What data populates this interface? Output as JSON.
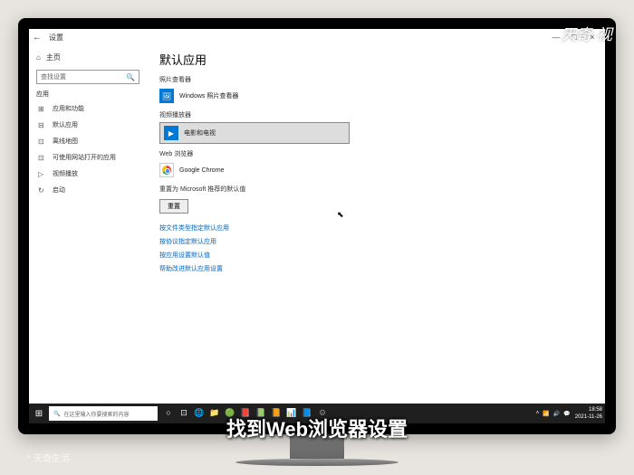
{
  "watermarks": {
    "top_right": "天奇·视",
    "caption": "找到Web浏览器设置",
    "bottom_left": "天奇生活"
  },
  "titlebar": {
    "back": "←",
    "title": "设置",
    "min": "—",
    "max": "□",
    "close": "×"
  },
  "sidebar": {
    "home_icon": "⌂",
    "home": "主页",
    "search_placeholder": "查找设置",
    "section": "应用",
    "items": [
      {
        "icon": "⊞",
        "label": "应用和功能"
      },
      {
        "icon": "⊟",
        "label": "默认应用"
      },
      {
        "icon": "⊡",
        "label": "离线地图"
      },
      {
        "icon": "⊡",
        "label": "可使用网站打开的应用"
      },
      {
        "icon": "▷",
        "label": "视频播放"
      },
      {
        "icon": "↻",
        "label": "启动"
      }
    ]
  },
  "content": {
    "heading": "默认应用",
    "sections": {
      "photo": {
        "label": "照片查看器",
        "app": "Windows 照片查看器"
      },
      "video": {
        "label": "视频播放器",
        "app": "电影和电视"
      },
      "web": {
        "label": "Web 浏览器",
        "app": "Google Chrome"
      }
    },
    "reset": {
      "label": "重置为 Microsoft 推荐的默认值",
      "button": "重置"
    },
    "links": [
      "按文件类型指定默认应用",
      "按协议指定默认应用",
      "按应用设置默认值",
      "帮助改进默认应用设置"
    ]
  },
  "taskbar": {
    "search": "在这里输入你要搜索的内容",
    "time": "18:58",
    "date": "2021-11-26"
  }
}
